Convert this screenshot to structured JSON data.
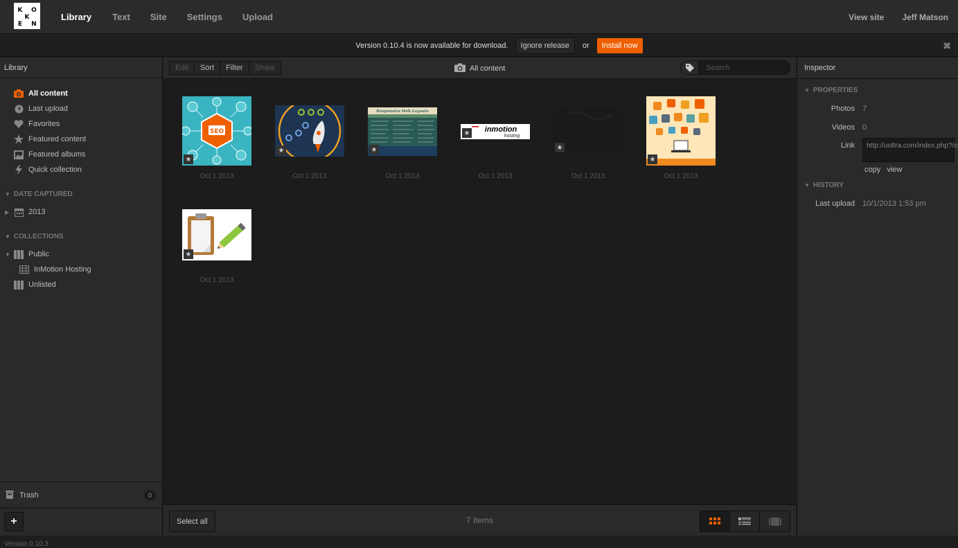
{
  "app": {
    "logo_letters": [
      "K",
      "O",
      "K",
      "E",
      "N"
    ],
    "nav": {
      "library": "Library",
      "text": "Text",
      "site": "Site",
      "settings": "Settings",
      "upload": "Upload"
    },
    "view_site": "View site",
    "user_name": "Jeff Matson",
    "accent_color": "#ee5f00"
  },
  "notice": {
    "text": "Version 0.10.4 is now available for download.",
    "ignore_label": "Ignore release",
    "or_label": "or",
    "install_label": "Install now",
    "close_glyph": "✖"
  },
  "sidebar": {
    "header": "Library",
    "items": [
      {
        "label": "All content",
        "icon": "camera-icon"
      },
      {
        "label": "Last upload",
        "icon": "clock-icon"
      },
      {
        "label": "Favorites",
        "icon": "heart-icon"
      },
      {
        "label": "Featured content",
        "icon": "star-icon"
      },
      {
        "label": "Featured albums",
        "icon": "album-icon"
      },
      {
        "label": "Quick collection",
        "icon": "bolt-icon"
      }
    ],
    "date_section": "DATE CAPTURED",
    "year": "2013",
    "collections_section": "COLLECTIONS",
    "public": "Public",
    "inmotion": "InMotion Hosting",
    "unlisted": "Unlisted",
    "trash_label": "Trash",
    "trash_count": "0",
    "add_label": "+"
  },
  "toolbar": {
    "edit": "Edit",
    "sort": "Sort",
    "filter": "Filter",
    "share": "Share",
    "title": "All content",
    "search_placeholder": "Search"
  },
  "grid": {
    "items": [
      {
        "date": "Oct 1 2013",
        "image": "seo-icons"
      },
      {
        "date": "Oct 1 2013",
        "image": "rocket"
      },
      {
        "date": "Oct 1 2013",
        "image": "responsive-web-layouts"
      },
      {
        "date": "Oct 1 2013",
        "image": "inmotion-hosting-logo"
      },
      {
        "date": "Oct 1 2013",
        "image": "dark-image"
      },
      {
        "date": "Oct 1 2013",
        "image": "cloud-icons"
      },
      {
        "date": "Oct 1 2013",
        "image": "clipboard-pencil"
      }
    ],
    "responsive_caption": "Responsive Web Layouts",
    "inmotion_word": "inmotion",
    "hosting_word": "hosting",
    "seo_word": "SEO"
  },
  "footer": {
    "select_all": "Select all",
    "count": "7 items"
  },
  "inspector": {
    "header": "Inspector",
    "properties_label": "PROPERTIES",
    "photos_label": "Photos",
    "photos_value": "7",
    "videos_label": "Videos",
    "videos_value": "0",
    "link_label": "Link",
    "link_value": "http://uoltra.com/index.php?/content/",
    "copy_label": "copy",
    "view_label": "view",
    "history_label": "HISTORY",
    "last_upload_label": "Last upload",
    "last_upload_value": "10/1/2013 1:53 pm"
  },
  "version_text": "Version 0.10.3"
}
